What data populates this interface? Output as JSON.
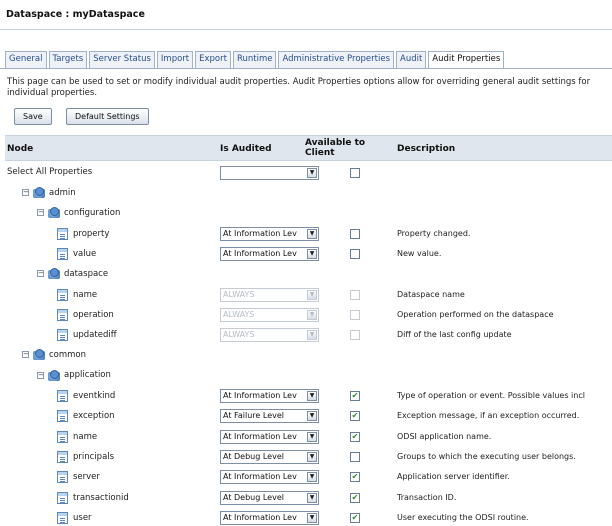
{
  "header": {
    "title": "Dataspace : myDataspace"
  },
  "tabs": [
    {
      "label": "General"
    },
    {
      "label": "Targets"
    },
    {
      "label": "Server Status"
    },
    {
      "label": "Import"
    },
    {
      "label": "Export"
    },
    {
      "label": "Runtime"
    },
    {
      "label": "Administrative Properties"
    },
    {
      "label": "Audit"
    },
    {
      "label": "Audit Properties"
    }
  ],
  "active_tab": "Audit Properties",
  "description": "This page can be used to set or modify individual audit properties. Audit Properties options allow for overriding general audit settings for individual properties.",
  "buttons": {
    "save": "Save",
    "default_settings": "Default Settings"
  },
  "columns": {
    "node": "Node",
    "is_audited": "Is Audited",
    "available": "Available to Client",
    "description": "Description"
  },
  "select_all": {
    "label": "Select All Properties",
    "value": ""
  },
  "tree": [
    {
      "label": "admin",
      "kind": "folder",
      "level": 0
    },
    {
      "label": "configuration",
      "kind": "folder",
      "level": 1
    },
    {
      "label": "property",
      "kind": "leaf",
      "level": 2,
      "audit": "At Information Lev",
      "checked": false,
      "disabled": false,
      "desc": "Property changed."
    },
    {
      "label": "value",
      "kind": "leaf",
      "level": 2,
      "audit": "At Information Lev",
      "checked": false,
      "disabled": false,
      "desc": "New value."
    },
    {
      "label": "dataspace",
      "kind": "folder",
      "level": 1
    },
    {
      "label": "name",
      "kind": "leaf",
      "level": 2,
      "audit": "ALWAYS",
      "checked": false,
      "disabled": true,
      "desc": "Dataspace name"
    },
    {
      "label": "operation",
      "kind": "leaf",
      "level": 2,
      "audit": "ALWAYS",
      "checked": false,
      "disabled": true,
      "desc": "Operation performed on the dataspace"
    },
    {
      "label": "updatediff",
      "kind": "leaf",
      "level": 2,
      "audit": "ALWAYS",
      "checked": false,
      "disabled": true,
      "desc": "Diff of the last config update"
    },
    {
      "label": "common",
      "kind": "folder",
      "level": 0
    },
    {
      "label": "application",
      "kind": "folder",
      "level": 1
    },
    {
      "label": "eventkind",
      "kind": "leaf",
      "level": 2,
      "audit": "At Information Lev",
      "checked": true,
      "disabled": false,
      "desc": "Type of operation or event. Possible values incl"
    },
    {
      "label": "exception",
      "kind": "leaf",
      "level": 2,
      "audit": "At Failure Level",
      "checked": true,
      "disabled": false,
      "desc": "Exception message, if an exception occurred."
    },
    {
      "label": "name",
      "kind": "leaf",
      "level": 2,
      "audit": "At Information Lev",
      "checked": true,
      "disabled": false,
      "desc": "ODSI application name."
    },
    {
      "label": "principals",
      "kind": "leaf",
      "level": 2,
      "audit": "At Debug Level",
      "checked": false,
      "disabled": false,
      "desc": "Groups to which the executing user belongs."
    },
    {
      "label": "server",
      "kind": "leaf",
      "level": 2,
      "audit": "At Information Lev",
      "checked": true,
      "disabled": false,
      "desc": "Application server identifier."
    },
    {
      "label": "transactionid",
      "kind": "leaf",
      "level": 2,
      "audit": "At Debug Level",
      "checked": true,
      "disabled": false,
      "desc": "Transaction ID."
    },
    {
      "label": "user",
      "kind": "leaf",
      "level": 2,
      "audit": "At Information Lev",
      "checked": true,
      "disabled": false,
      "desc": "User executing the ODSI routine."
    }
  ],
  "colors": {
    "tab_text": "#2a4d8f",
    "header_bg": "#dfe6ee",
    "check": "#2d8a2d"
  }
}
